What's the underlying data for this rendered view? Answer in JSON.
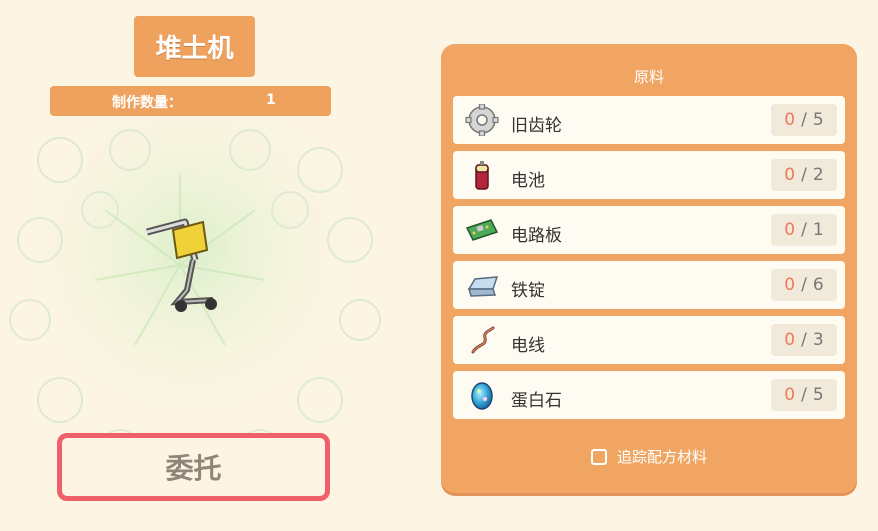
{
  "item": {
    "name": "堆土机",
    "quantity_label": "制作数量：",
    "quantity": "1"
  },
  "commission_label": "委托",
  "materials_panel": {
    "title": "原料",
    "items": [
      {
        "name": "旧齿轮",
        "icon": "gear-icon",
        "have": "0",
        "need": "5"
      },
      {
        "name": "电池",
        "icon": "battery-icon",
        "have": "0",
        "need": "2"
      },
      {
        "name": "电路板",
        "icon": "circuit-board-icon",
        "have": "0",
        "need": "1"
      },
      {
        "name": "铁锭",
        "icon": "iron-ingot-icon",
        "have": "0",
        "need": "6"
      },
      {
        "name": "电线",
        "icon": "wire-icon",
        "have": "0",
        "need": "3"
      },
      {
        "name": "蛋白石",
        "icon": "opal-icon",
        "have": "0",
        "need": "5"
      }
    ],
    "track_label": "追踪配方材料",
    "track_checked": false
  },
  "colors": {
    "accent_orange": "#efa25e",
    "button_border": "#f0606a",
    "count_have": "#ef7a5a"
  }
}
